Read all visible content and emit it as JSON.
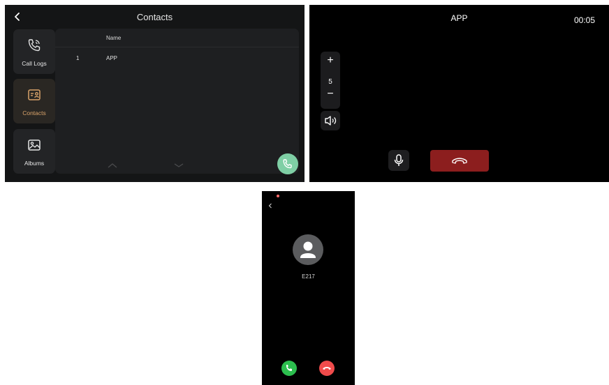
{
  "contacts_screen": {
    "title": "Contacts",
    "sidebar": [
      {
        "label": "Call Logs",
        "icon": "call-logs-icon"
      },
      {
        "label": "Contacts",
        "icon": "contacts-icon",
        "active": true
      },
      {
        "label": "Albums",
        "icon": "albums-icon"
      }
    ],
    "table": {
      "header": "Name",
      "rows": [
        {
          "index": "1",
          "name": "APP"
        }
      ]
    }
  },
  "call_screen": {
    "caller": "APP",
    "timer": "00:05",
    "volume_plus": "+",
    "volume_level": "5",
    "volume_minus": "−"
  },
  "incoming_screen": {
    "name": "E217"
  },
  "colors": {
    "accent": "#d9a36a",
    "hangup": "#8c1e1e",
    "accept": "#2cbe4e",
    "decline": "#f04b4b",
    "fab": "#7fcfa5"
  }
}
